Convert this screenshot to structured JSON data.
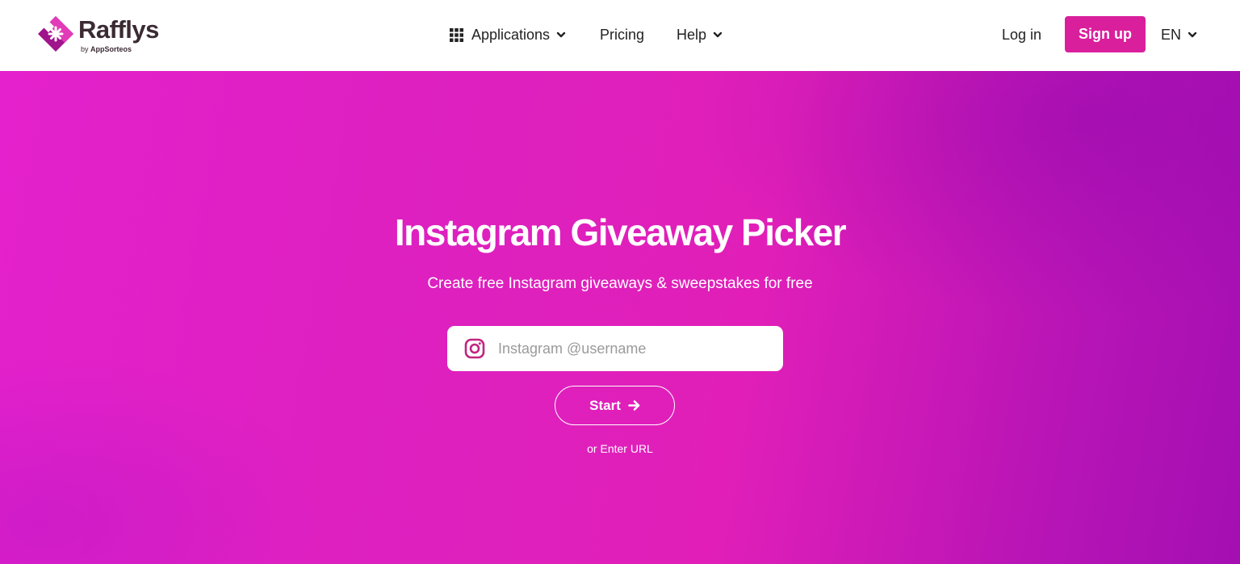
{
  "brand": {
    "name": "Rafflys",
    "by_prefix": "by",
    "by_company": "AppSorteos",
    "colors": {
      "mark_dark": "#a0148c",
      "mark_light": "#e23bb7",
      "text": "#3b2a33"
    }
  },
  "nav": {
    "items": [
      {
        "label": "Applications",
        "icon": "grid-icon",
        "has_dropdown": true
      },
      {
        "label": "Pricing",
        "has_dropdown": false
      },
      {
        "label": "Help",
        "has_dropdown": true
      }
    ],
    "login_label": "Log in",
    "signup_label": "Sign up",
    "language": "EN"
  },
  "hero": {
    "title": "Instagram Giveaway Picker",
    "subtitle": "Create free Instagram giveaways & sweepstakes for free",
    "search": {
      "placeholder": "Instagram @username",
      "value": "",
      "icon": "instagram-icon"
    },
    "start_label": "Start",
    "enter_url_label": "or Enter URL"
  },
  "colors": {
    "accent": "#d91f9c",
    "hero_gradient_start": "#e421cc",
    "hero_gradient_end": "#a40fb2",
    "instagram_icon": "#c2257f"
  }
}
